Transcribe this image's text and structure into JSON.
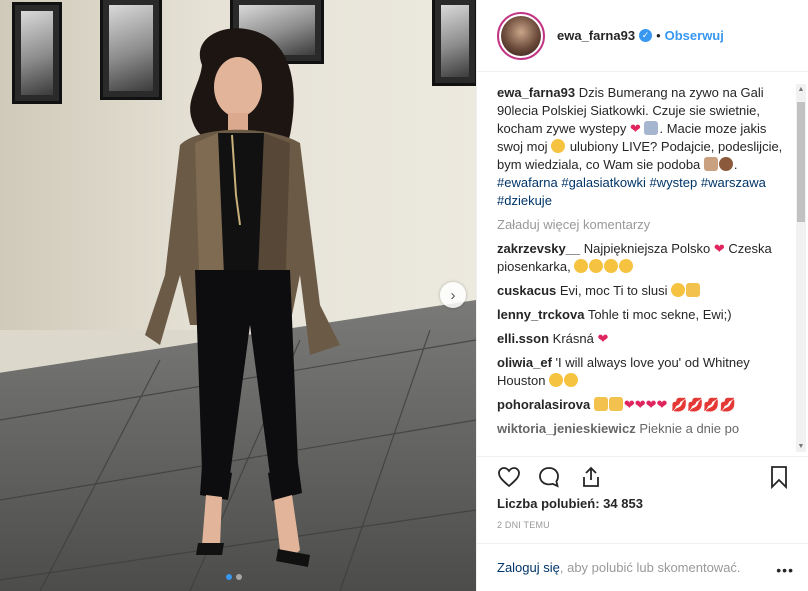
{
  "post": {
    "username": "ewa_farna93",
    "follow_label": "Obserwuj",
    "separator": "•"
  },
  "caption": {
    "user": "ewa_farna93",
    "text": "Dzis Bumerang na zywo na Gali 90lecia Polskiej Siatkowki. Czuje sie swietnie, kocham zywe wystepy",
    "text2": "Macie moze jakis swoj moj",
    "text3": "ulubiony LIVE? Podajcie, podeslijcie, bym wiedziala, co Wam sie podoba",
    "hashtags": [
      "#ewafarna",
      "#galasiatkowki",
      "#wystep",
      "#warszawa",
      "#dziekuje"
    ]
  },
  "load_more_label": "Załaduj więcej komentarzy",
  "comments": [
    {
      "user": "zakrzevsky__",
      "text": "Najpiękniejsza Polsko",
      "text2": "Czeska piosenkarka,"
    },
    {
      "user": "cuskacus",
      "text": "Evi, moc Ti to slusi"
    },
    {
      "user": "lenny_trckova",
      "text": "Tohle ti moc sekne, Ewi;)"
    },
    {
      "user": "elli.sson",
      "text": "Krásná"
    },
    {
      "user": "oliwia_ef",
      "text": "'I will always love you' od Whitney Houston"
    },
    {
      "user": "pohoralasirova",
      "text": ""
    },
    {
      "user": "wiktoria_jenieskiewicz",
      "text": "Pieknie a dnie po"
    }
  ],
  "likes_label": "Liczba polubień: 34 853",
  "date_label": "2 DNI TEMU",
  "login": {
    "link": "Zaloguj się",
    "text": ", aby polubić lub skomentować."
  },
  "more_menu": "•••",
  "colors": {
    "accent": "#3897f0",
    "hashtag": "#003569",
    "heart": "#e0245e"
  }
}
